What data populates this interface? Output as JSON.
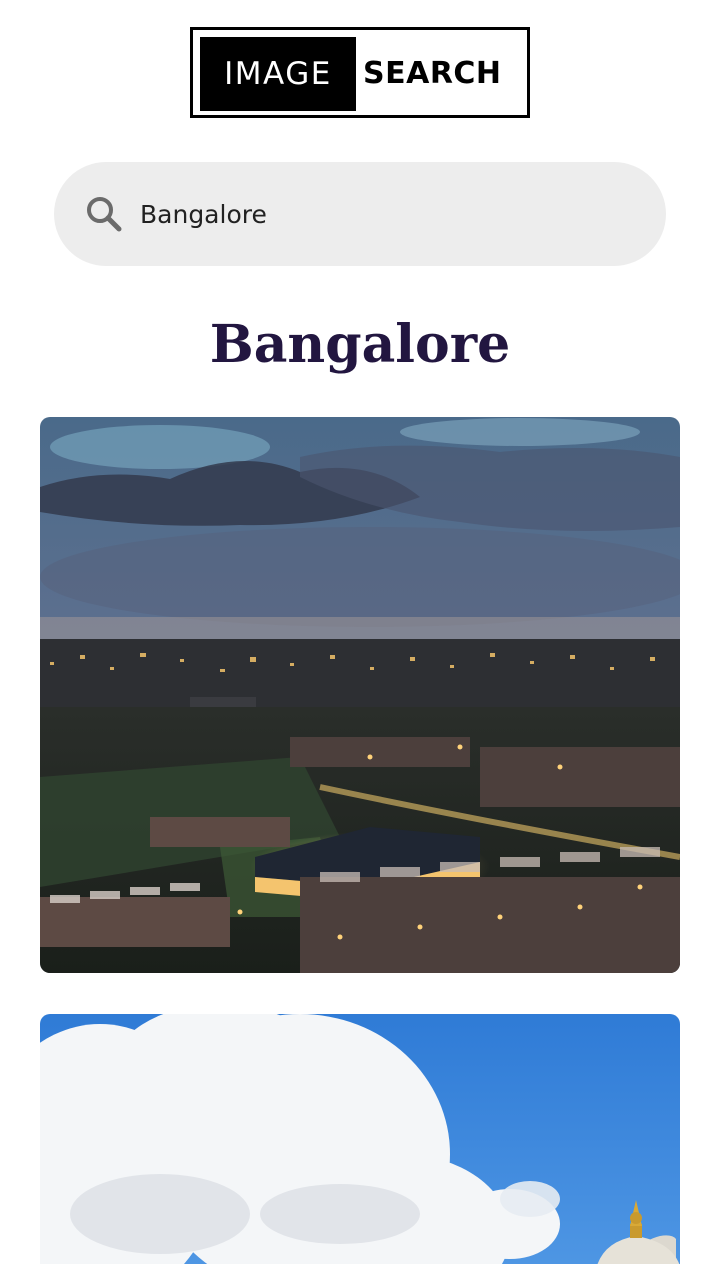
{
  "logo": {
    "word_left": "IMAGE",
    "word_right": "SEARCH"
  },
  "search": {
    "value": "Bangalore",
    "icon": "search-icon"
  },
  "results": {
    "heading": "Bangalore",
    "images": [
      {
        "subject": "city-night-aerial",
        "icon": "photo"
      },
      {
        "subject": "clouds-sky-dome",
        "icon": "photo"
      }
    ]
  },
  "colors": {
    "heading": "#221640",
    "search_bg": "#ededed",
    "logo_dark": "#000000"
  }
}
